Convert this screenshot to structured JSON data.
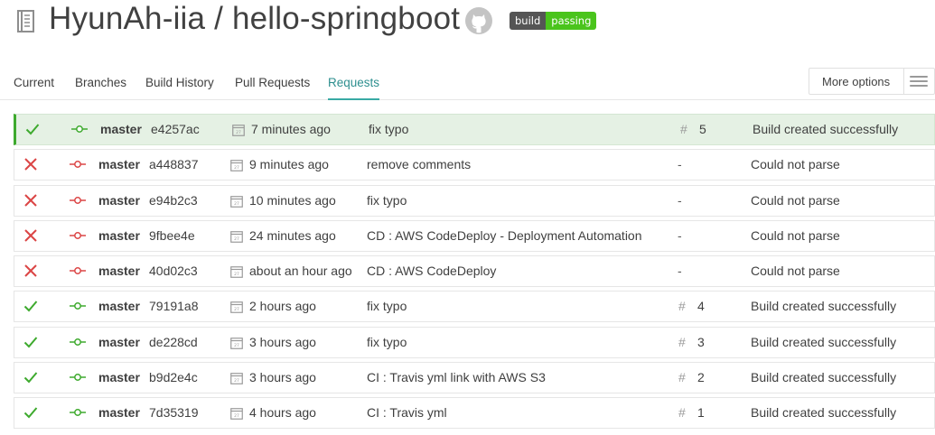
{
  "header": {
    "repo_title": "HyunAh-iia / hello-springboot",
    "badge_left": "build",
    "badge_right": "passing",
    "badge_color": "#4ac41c",
    "repo_icon": "repo-book-icon",
    "github_icon": "github-octocat-icon"
  },
  "tabs": [
    {
      "label": "Current",
      "active": false
    },
    {
      "label": "Branches",
      "active": false
    },
    {
      "label": "Build History",
      "active": false
    },
    {
      "label": "Pull Requests",
      "active": false
    },
    {
      "label": "Requests",
      "active": true
    }
  ],
  "more_options": {
    "label": "More options",
    "icon": "hamburger-menu-icon"
  },
  "colors": {
    "success": "#3eaa2e",
    "failure": "#db4545",
    "accent": "#39aaa4"
  },
  "rows": [
    {
      "status": "success",
      "branch": "master",
      "sha": "e4257ac",
      "time": "7 minutes ago",
      "message": "fix typo",
      "build": "5",
      "result": "Build created successfully",
      "current": true
    },
    {
      "status": "failure",
      "branch": "master",
      "sha": "a448837",
      "time": "9 minutes ago",
      "message": "remove comments",
      "build": "-",
      "result": "Could not parse",
      "current": false
    },
    {
      "status": "failure",
      "branch": "master",
      "sha": "e94b2c3",
      "time": "10 minutes ago",
      "message": "fix typo",
      "build": "-",
      "result": "Could not parse",
      "current": false
    },
    {
      "status": "failure",
      "branch": "master",
      "sha": "9fbee4e",
      "time": "24 minutes ago",
      "message": "CD : AWS CodeDeploy - Deployment Automation",
      "build": "-",
      "result": "Could not parse",
      "current": false
    },
    {
      "status": "failure",
      "branch": "master",
      "sha": "40d02c3",
      "time": "about an hour ago",
      "message": "CD : AWS CodeDeploy",
      "build": "-",
      "result": "Could not parse",
      "current": false
    },
    {
      "status": "success",
      "branch": "master",
      "sha": "79191a8",
      "time": "2 hours ago",
      "message": "fix typo",
      "build": "4",
      "result": "Build created successfully",
      "current": false
    },
    {
      "status": "success",
      "branch": "master",
      "sha": "de228cd",
      "time": "3 hours ago",
      "message": "fix typo",
      "build": "3",
      "result": "Build created successfully",
      "current": false
    },
    {
      "status": "success",
      "branch": "master",
      "sha": "b9d2e4c",
      "time": "3 hours ago",
      "message": "CI : Travis yml link with AWS S3",
      "build": "2",
      "result": "Build created successfully",
      "current": false
    },
    {
      "status": "success",
      "branch": "master",
      "sha": "7d35319",
      "time": "4 hours ago",
      "message": "CI : Travis yml",
      "build": "1",
      "result": "Build created successfully",
      "current": false
    }
  ]
}
